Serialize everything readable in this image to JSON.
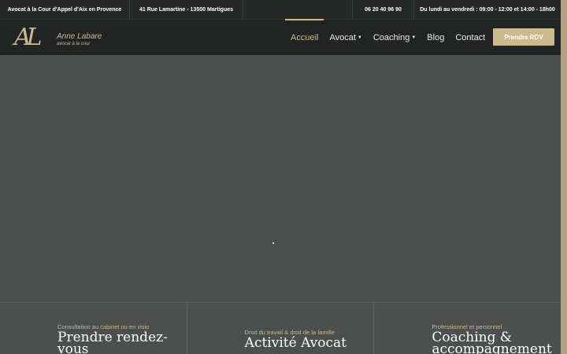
{
  "topbar": {
    "court": "Avocat à la Cour d'Appel d'Aix en Provence",
    "address": "41 Rue Lamartine - 13500 Martigues",
    "phone": "06 20 40 96 90",
    "hours": "Du lundi au vendredi : 09:00 - 12:00 et 14:00 - 18h00"
  },
  "logo": {
    "monogram": "AL",
    "name": "Anne Labare",
    "subtitle": "avocat à la cour"
  },
  "nav": {
    "items": [
      {
        "label": "Accueil"
      },
      {
        "label": "Avocat"
      },
      {
        "label": "Coaching"
      },
      {
        "label": "Blog"
      },
      {
        "label": "Contact"
      }
    ],
    "cta": "Prendre RDV"
  },
  "cards": [
    {
      "kicker": "Consultation au cabinet ou en visio",
      "title": "Prendre rendez-vous"
    },
    {
      "kicker": "Droit du travail & droit de la famille",
      "title": "Activité Avocat"
    },
    {
      "kicker": "Professionnel et personnel",
      "title": "Coaching & accompagnement"
    }
  ],
  "colors": {
    "accent": "#cdb98e",
    "header_bg": "#222424",
    "hero_bg": "#4b4f4e"
  }
}
